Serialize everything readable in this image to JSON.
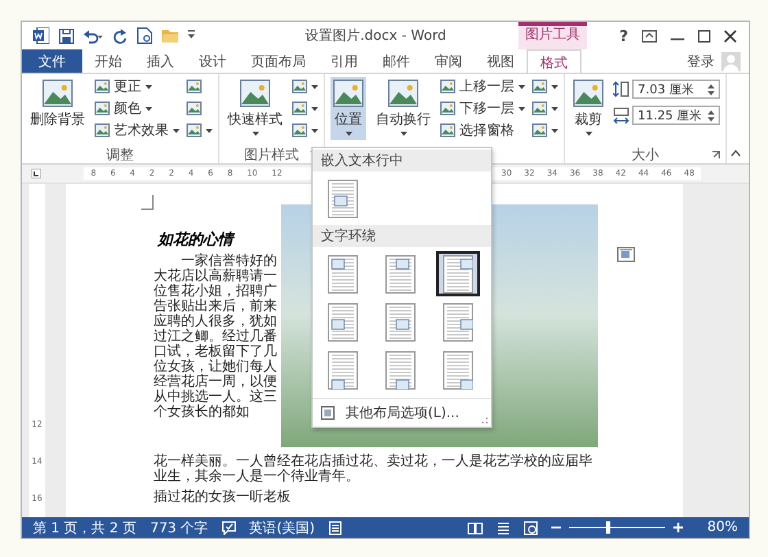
{
  "title_bar": {
    "title": "设置图片.docx - Word",
    "context_tab": "图片工具",
    "help": "?"
  },
  "ribbon_tabs": [
    {
      "label": "文件",
      "kind": "file",
      "selected": false
    },
    {
      "label": "开始",
      "kind": "normal",
      "selected": false
    },
    {
      "label": "插入",
      "kind": "normal",
      "selected": false
    },
    {
      "label": "设计",
      "kind": "normal",
      "selected": false
    },
    {
      "label": "页面布局",
      "kind": "normal",
      "selected": false
    },
    {
      "label": "引用",
      "kind": "normal",
      "selected": false
    },
    {
      "label": "邮件",
      "kind": "normal",
      "selected": false
    },
    {
      "label": "审阅",
      "kind": "normal",
      "selected": false
    },
    {
      "label": "视图",
      "kind": "normal",
      "selected": false
    },
    {
      "label": "格式",
      "kind": "context",
      "selected": true
    }
  ],
  "account": {
    "label": "登录"
  },
  "ribbon_groups": [
    {
      "label": "调整",
      "launcher": false,
      "controls": [
        {
          "kind": "big",
          "label": "删除背景",
          "dropdown": false,
          "selected": false
        },
        {
          "kind": "list",
          "items": [
            {
              "label": "更正",
              "dropdown": true
            },
            {
              "label": "颜色",
              "dropdown": true
            },
            {
              "label": "艺术效果",
              "dropdown": true
            }
          ]
        },
        {
          "kind": "icons",
          "items": [
            {
              "dropdown": false
            },
            {
              "dropdown": false
            },
            {
              "dropdown": true
            }
          ]
        }
      ]
    },
    {
      "label": "图片样式",
      "launcher": true,
      "controls": [
        {
          "kind": "big",
          "label": "快速样式",
          "dropdown": true,
          "selected": false
        },
        {
          "kind": "icons",
          "items": [
            {
              "dropdown": true
            },
            {
              "dropdown": true
            },
            {
              "dropdown": true
            }
          ]
        }
      ]
    },
    {
      "controls": [
        {
          "kind": "big",
          "label": "位置",
          "dropdown": true,
          "selected": true
        },
        {
          "kind": "big",
          "label": "自动换行",
          "dropdown": true,
          "selected": false
        },
        {
          "kind": "list",
          "items": [
            {
              "label": "上移一层",
              "dropdown": true
            },
            {
              "label": "下移一层",
              "dropdown": true
            },
            {
              "label": "选择窗格",
              "dropdown": false
            }
          ]
        },
        {
          "kind": "icons",
          "items": [
            {
              "dropdown": true
            },
            {
              "dropdown": true
            },
            {
              "dropdown": true
            }
          ]
        }
      ]
    },
    {
      "label": "大小",
      "launcher": true,
      "controls": [
        {
          "kind": "big",
          "label": "裁剪",
          "dropdown": true,
          "selected": false
        },
        {
          "kind": "spin",
          "items": [
            {
              "value": "7.03 厘米"
            },
            {
              "value": "11.25 厘米"
            }
          ]
        }
      ]
    }
  ],
  "ruler": {
    "left_numbers": [
      "8",
      "6",
      "4",
      "2",
      "2",
      "4",
      "6",
      "8",
      "10",
      "12"
    ],
    "right_numbers": [
      "30",
      "32",
      "34",
      "36",
      "38",
      "42",
      "44",
      "46",
      "48"
    ]
  },
  "vertical_ruler": {
    "numbers": [
      "12",
      "14",
      "16"
    ]
  },
  "document": {
    "heading": "如花的心情",
    "text_beside_picture": "一家信誉特好的大花店以高薪聘请一位售花小姐，招聘广告张贴出来后，前来应聘的人很多，犹如过江之鲫。经过几番口试，老板留下了几位女孩，让她们每人经营花店一周，以便从中挑选一人。这三个女孩长的都如",
    "text_below_picture": "花一样美丽。一人曾经在花店插过花、卖过花，一人是花艺学校的应届毕业生，其余一人是一个待业青年。",
    "last_line": "插过花的女孩一听老板"
  },
  "layout_menu": {
    "sections": [
      {
        "title": "嵌入文本行中",
        "options": [
          {
            "selected": false
          }
        ]
      },
      {
        "title": "文字环绕",
        "options": [
          {
            "selected": false
          },
          {
            "selected": false
          },
          {
            "selected": true
          },
          {
            "selected": false
          },
          {
            "selected": false
          },
          {
            "selected": false
          },
          {
            "selected": false
          },
          {
            "selected": false
          },
          {
            "selected": false
          }
        ]
      }
    ],
    "more": "其他布局选项(L)..."
  },
  "status_bar": {
    "page": "第 1 页，共 2 页",
    "words": "773 个字",
    "language": "英语(美国)",
    "zoom": {
      "level": 0.4,
      "label": "80%"
    }
  }
}
